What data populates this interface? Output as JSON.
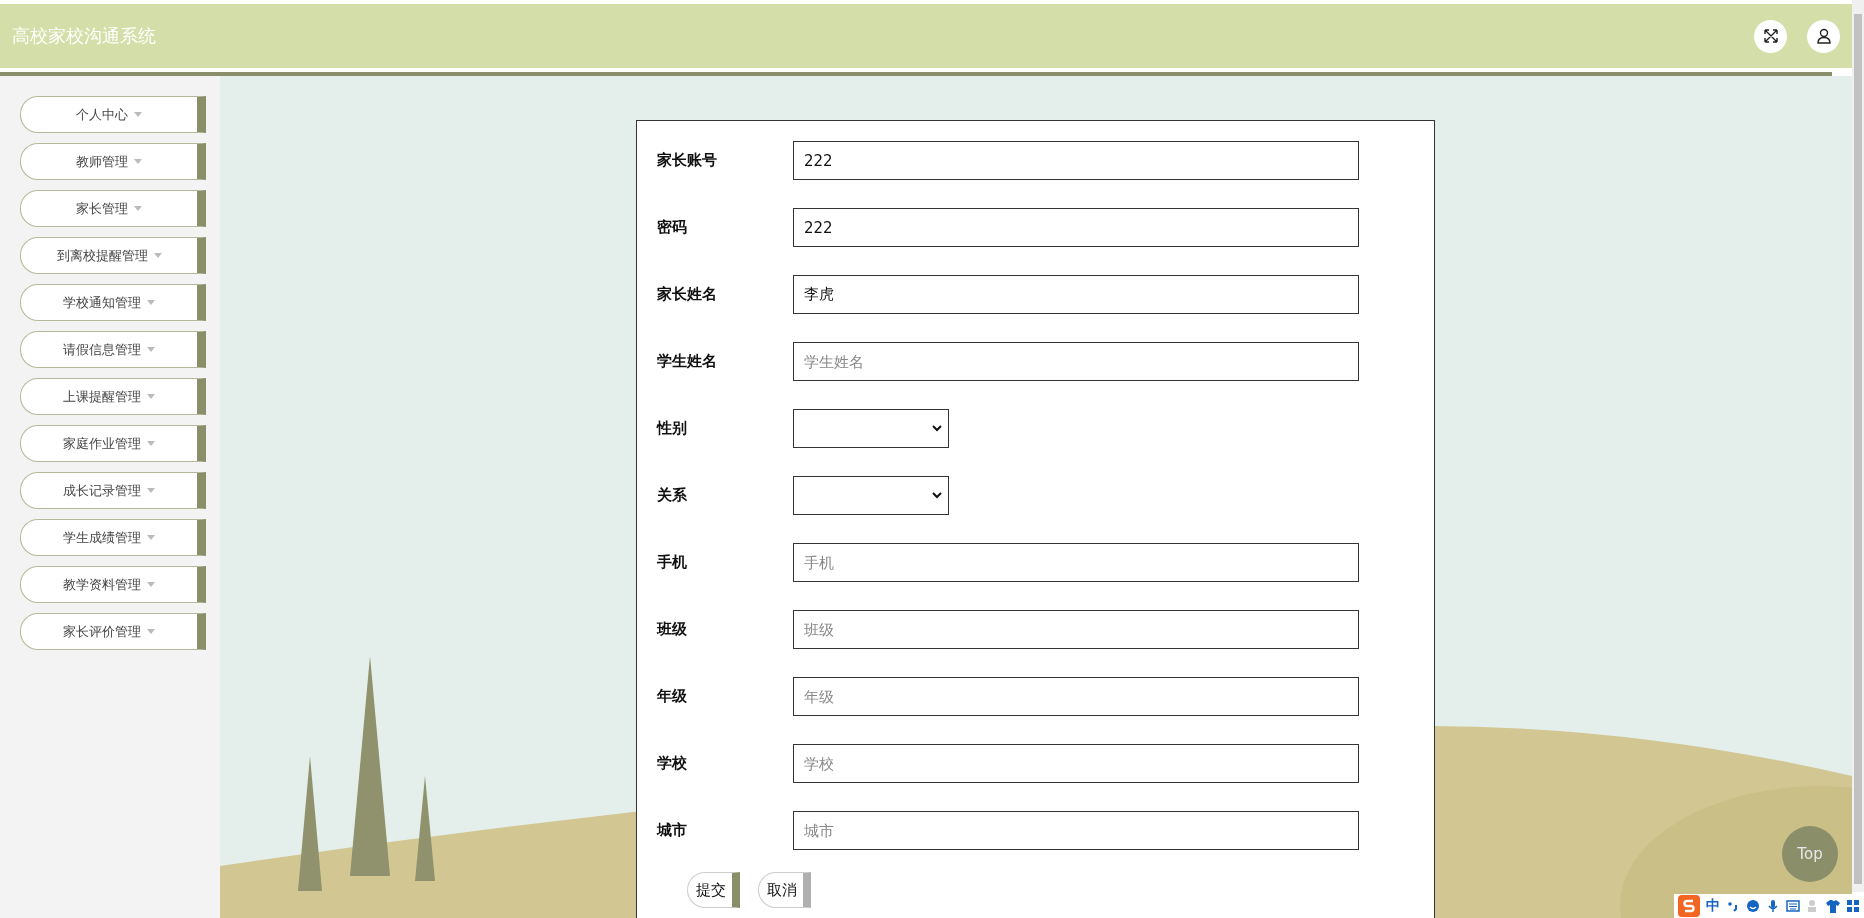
{
  "header": {
    "title": "高校家校沟通系统"
  },
  "sidebar": {
    "items": [
      {
        "label": "个人中心"
      },
      {
        "label": "教师管理"
      },
      {
        "label": "家长管理"
      },
      {
        "label": "到离校提醒管理"
      },
      {
        "label": "学校通知管理"
      },
      {
        "label": "请假信息管理"
      },
      {
        "label": "上课提醒管理"
      },
      {
        "label": "家庭作业管理"
      },
      {
        "label": "成长记录管理"
      },
      {
        "label": "学生成绩管理"
      },
      {
        "label": "教学资料管理"
      },
      {
        "label": "家长评价管理"
      }
    ]
  },
  "form": {
    "fields": [
      {
        "kind": "text",
        "label": "家长账号",
        "value": "222"
      },
      {
        "kind": "text",
        "label": "密码",
        "value": "222"
      },
      {
        "kind": "text",
        "label": "家长姓名",
        "value": "李虎"
      },
      {
        "kind": "text",
        "label": "学生姓名",
        "placeholder": "学生姓名"
      },
      {
        "kind": "select",
        "label": "性别"
      },
      {
        "kind": "select",
        "label": "关系"
      },
      {
        "kind": "text",
        "label": "手机",
        "placeholder": "手机"
      },
      {
        "kind": "text",
        "label": "班级",
        "placeholder": "班级"
      },
      {
        "kind": "text",
        "label": "年级",
        "placeholder": "年级"
      },
      {
        "kind": "text",
        "label": "学校",
        "placeholder": "学校"
      },
      {
        "kind": "text",
        "label": "城市",
        "placeholder": "城市"
      }
    ],
    "buttons": [
      {
        "label": "提交",
        "kind": "primary"
      },
      {
        "label": "取消",
        "kind": "secondary"
      }
    ]
  },
  "top_button": {
    "label": "Top"
  },
  "ime_toolbar": {
    "mode": "中"
  }
}
